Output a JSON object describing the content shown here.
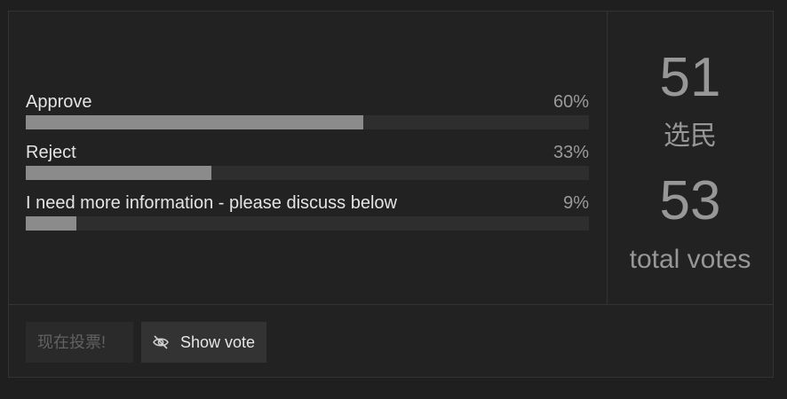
{
  "poll": {
    "options": [
      {
        "label": "Approve",
        "percent_label": "60%",
        "percent": 60
      },
      {
        "label": "Reject",
        "percent_label": "33%",
        "percent": 33
      },
      {
        "label": "I need more information - please discuss below",
        "percent_label": "9%",
        "percent": 9
      }
    ],
    "stats": {
      "voters_count": "51",
      "voters_label": "选民",
      "total_votes_count": "53",
      "total_votes_label": "total votes"
    },
    "footer": {
      "vote_button_label": "现在投票!",
      "show_vote_button_label": "Show vote",
      "show_vote_icon": "eye-slash-icon"
    },
    "colors": {
      "bar_fill": "#8b8b8b",
      "bar_track": "#2e2e2e",
      "background": "#222222"
    }
  }
}
